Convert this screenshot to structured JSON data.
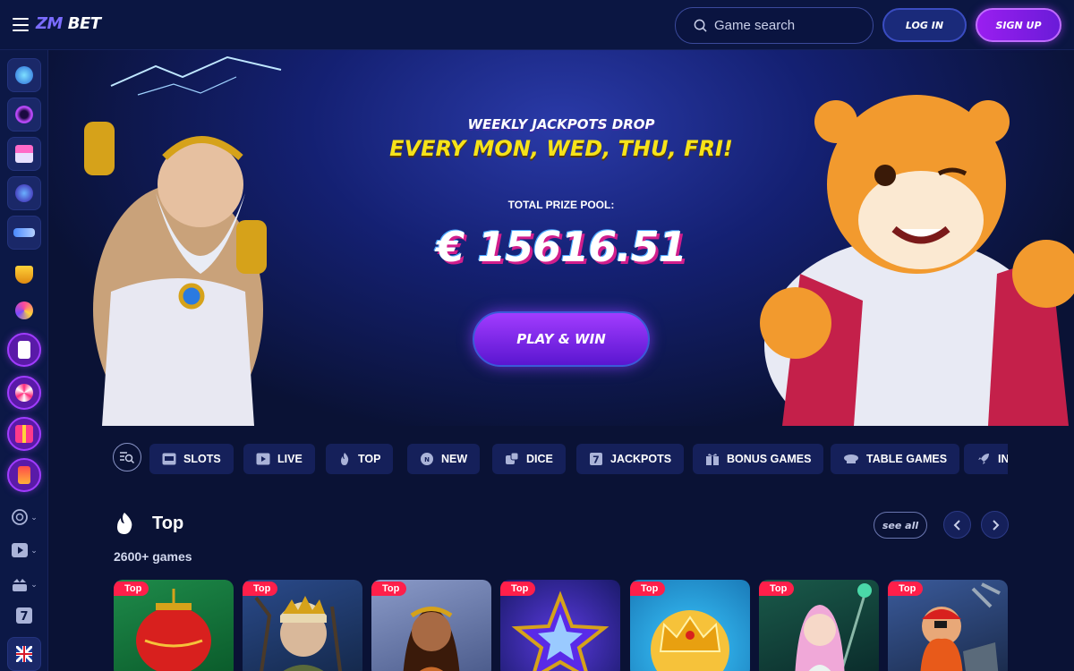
{
  "header": {
    "logo_prefix": "ZM",
    "logo_suffix": " BET",
    "search_placeholder": "Game search",
    "login_label": "LOG IN",
    "signup_label": "SIGN UP"
  },
  "hero": {
    "subtitle": "WEEKLY JACKPOTS DROP",
    "title": "EVERY MON, WED, THU, FRI!",
    "prize_label": "TOTAL PRIZE POOL:",
    "prize_amount": "€ 15616.51",
    "cta_label": "PLAY & WIN"
  },
  "categories": [
    {
      "label": "SLOTS",
      "icon": "slots-icon"
    },
    {
      "label": "LIVE",
      "icon": "play-icon"
    },
    {
      "label": "TOP",
      "icon": "fire-icon"
    },
    {
      "label": "NEW",
      "icon": "new-badge-icon"
    },
    {
      "label": "DICE",
      "icon": "dice-icon"
    },
    {
      "label": "JACKPOTS",
      "icon": "seven-icon"
    },
    {
      "label": "BONUS GAMES",
      "icon": "gift-icon"
    },
    {
      "label": "TABLE GAMES",
      "icon": "table-icon"
    },
    {
      "label": "IN",
      "icon": "rocket-icon"
    }
  ],
  "top_section": {
    "title": "Top",
    "count": "2600+ games",
    "see_all_label": "see all"
  },
  "tiles": [
    {
      "badge": "Top",
      "art": "red-lantern"
    },
    {
      "badge": "Top",
      "art": "old-witch"
    },
    {
      "badge": "Top",
      "art": "warrior-woman"
    },
    {
      "badge": "Top",
      "art": "purple-star"
    },
    {
      "badge": "Top",
      "art": "gold-crown"
    },
    {
      "badge": "Top",
      "art": "fairy-girl"
    },
    {
      "badge": "Top",
      "art": "pirate-dwarf"
    }
  ],
  "colors": {
    "background": "#0a1235",
    "accent_purple": "#9a1ef0",
    "hero_yellow": "#f6e31a",
    "badge_red": "#ff1f4a"
  }
}
